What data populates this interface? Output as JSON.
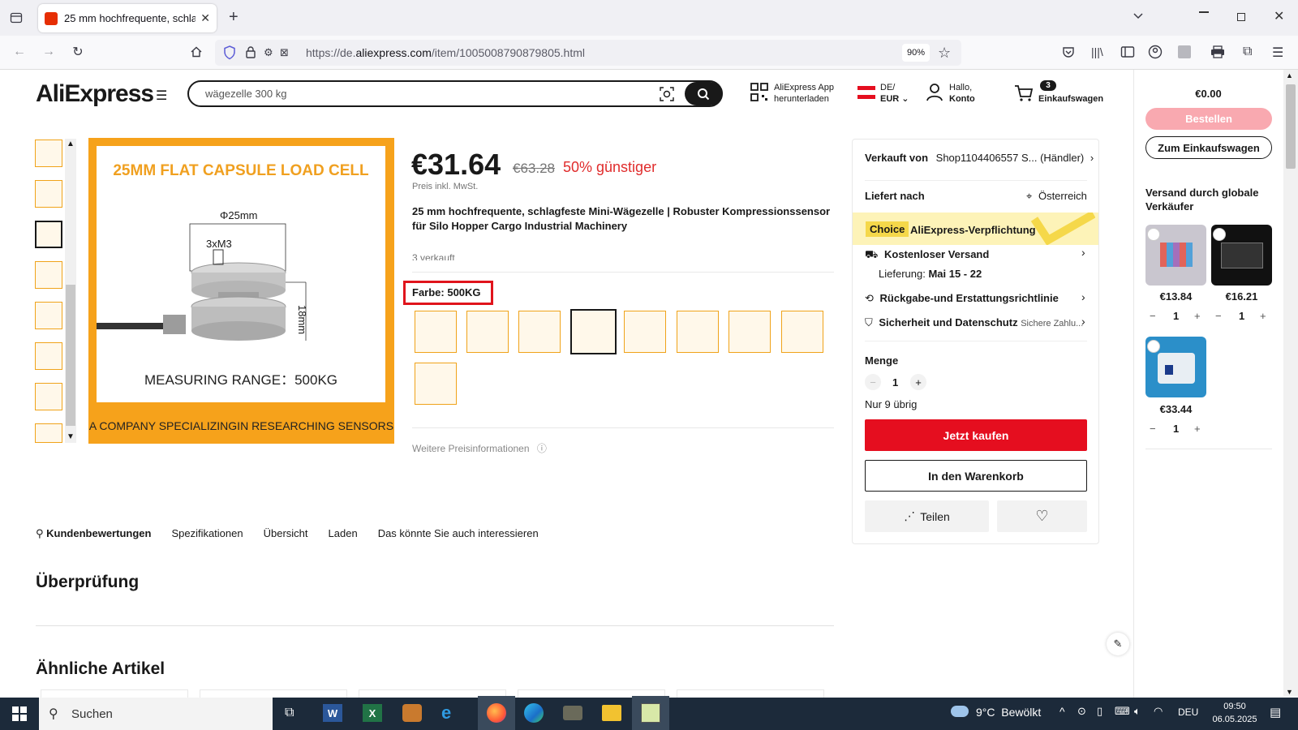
{
  "browser": {
    "tab_title": "25 mm hochfrequente, schlagfe",
    "url_prefix": "https://de.",
    "url_domain": "aliexpress.com",
    "url_path": "/item/1005008790879805.html",
    "zoom": "90%"
  },
  "header": {
    "logo": "AliExpress",
    "search_value": "wägezelle 300 kg",
    "app_line1": "AliExpress App",
    "app_line2": "herunterladen",
    "locale_line1": "DE/",
    "locale_line2": "EUR",
    "account_line1": "Hallo,",
    "account_line2": "Konto",
    "cart_count": "3",
    "cart_label": "Einkaufswagen"
  },
  "main_image": {
    "heading": "25MM FLAT CAPSULE LOAD CELL",
    "dim_diameter": "Φ25mm",
    "dim_thread": "3xM3",
    "dim_height": "18mm",
    "range": "MEASURING RANGE：500KG",
    "footer": "A COMPANY SPECIALIZINGIN RESEARCHING SENSORS"
  },
  "product": {
    "price": "€31.64",
    "old_price": "€63.28",
    "discount": "50% günstiger",
    "tax_note": "Preis inkl. MwSt.",
    "title": "25 mm hochfrequente, schlagfeste Mini-Wägezelle | Robuster Kompressionssensor für Silo Hopper Cargo Industrial Machinery",
    "sold": "3 verkauft",
    "variant_label": "Farbe: 500KG",
    "more_price": "Weitere Preisinformationen"
  },
  "buy_panel": {
    "seller_label": "Verkauft von",
    "seller_name": "Shop1104406557 S... (Händler)",
    "ship_to_label": "Liefert nach",
    "ship_to_value": "Österreich",
    "choice_badge": "Choice",
    "choice_text": "AliExpress-Verpflichtung",
    "free_shipping": "Kostenloser Versand",
    "delivery_label": "Lieferung:",
    "delivery_value": "Mai 15 - 22",
    "returns": "Rückgabe-und Erstattungsrichtlinie",
    "security": "Sicherheit und Datenschutz",
    "security_sub": "Sichere Zahlu...",
    "qty_label": "Menge",
    "qty_value": "1",
    "stock": "Nur 9 übrig",
    "buy_now": "Jetzt kaufen",
    "add_cart": "In den Warenkorb",
    "share": "Teilen"
  },
  "tabs": [
    "Kundenbewertungen",
    "Spezifikationen",
    "Übersicht",
    "Laden",
    "Das könnte Sie auch interessieren"
  ],
  "sections": {
    "review_heading": "Überprüfung",
    "similar_heading": "Ähnliche Artikel"
  },
  "mini_cart": {
    "total": "€0.00",
    "order_btn": "Bestellen",
    "to_cart_btn": "Zum Einkaufswagen",
    "shipping_heading": "Versand durch globale Verkäufer",
    "items": [
      {
        "price": "€13.84",
        "qty": "1"
      },
      {
        "price": "€16.21",
        "qty": "1"
      },
      {
        "price": "€33.44",
        "qty": "1"
      }
    ]
  },
  "taskbar": {
    "search": "Suchen",
    "weather": "9°C  Bewölkt",
    "lang": "DEU",
    "time": "09:50",
    "date": "06.05.2025"
  },
  "colors": {
    "accent_red": "#e50e1f",
    "discount_red": "#e02c2c",
    "image_orange": "#f6a21b",
    "choice_yellow": "#fdf3b8"
  }
}
